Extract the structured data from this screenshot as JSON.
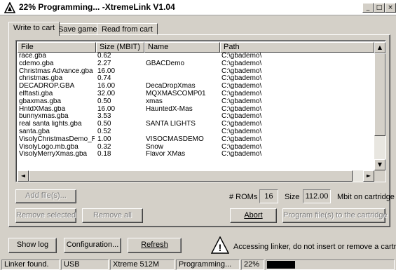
{
  "window": {
    "title": "22% Programming... -XtremeLink V1.04",
    "minimize": "_",
    "maximize": "□",
    "close": "×"
  },
  "tabs": [
    {
      "label": "Write to cart",
      "active": true
    },
    {
      "label": "Save games",
      "active": false
    },
    {
      "label": "Read from cart",
      "active": false
    }
  ],
  "table": {
    "columns": [
      "File",
      "Size (MBIT)",
      "Name",
      "Path"
    ],
    "rows": [
      [
        "race.gba",
        "0.62",
        "",
        "C:\\gbademo\\"
      ],
      [
        "cdemo.gba",
        "2.27",
        "GBACDemo",
        "C:\\gbademo\\"
      ],
      [
        "Christmas Advance.gba",
        "16.00",
        "",
        "C:\\gbademo\\"
      ],
      [
        "christmas.gba",
        "0.74",
        "",
        "C:\\gbademo\\"
      ],
      [
        "DECADROP.GBA",
        "16.00",
        "DecaDropXmas",
        "C:\\gbademo\\"
      ],
      [
        "elftasti.gba",
        "32.00",
        "MQXMASCOMP01",
        "C:\\gbademo\\"
      ],
      [
        "gbaxmas.gba",
        "0.50",
        "xmas",
        "C:\\gbademo\\"
      ],
      [
        "HntdXMas.gba",
        "16.00",
        "HauntedX-Mas",
        "C:\\gbademo\\"
      ],
      [
        "bunnyxmas.gba",
        "3.53",
        "",
        "C:\\gbademo\\"
      ],
      [
        "real santa lights.gba",
        "0.50",
        "SANTA LIGHTS",
        "C:\\gbademo\\"
      ],
      [
        "santa.gba",
        "0.52",
        "",
        "C:\\gbademo\\"
      ],
      [
        "VisolyChristmasDemo_R...",
        "1.00",
        "VISOCMASDEMO",
        "C:\\gbademo\\"
      ],
      [
        "VisolyLogo.mb.gba",
        "0.32",
        "Snow",
        "C:\\gbademo\\"
      ],
      [
        "VisolyMerryXmas.gba",
        "0.18",
        "Flavor XMas",
        "C:\\gbademo\\"
      ]
    ]
  },
  "scroll": {
    "up": "▲",
    "down": "▼",
    "left": "◄",
    "right": "►"
  },
  "buttons": {
    "add_files": "Add file(s)...",
    "remove_selected": "Remove selected",
    "remove_all": "Remove all",
    "abort": "Abort",
    "program": "Program file(s) to the cartridge",
    "show_log": "Show log",
    "configuration": "Configuration...",
    "refresh": "Refresh"
  },
  "stats": {
    "roms_label": "# ROMs",
    "roms_value": "16",
    "size_label": "Size",
    "size_value": "112.00",
    "mbit_label": "Mbit on cartridge"
  },
  "warning": {
    "icon_glyph": "!",
    "text": "Accessing linker, do not insert or remove a cartridge"
  },
  "status": {
    "linker": "Linker found.",
    "port": "USB",
    "cart": "Xtreme 512M",
    "state": "Programming...",
    "percent": "22%",
    "progress": 0.22
  }
}
